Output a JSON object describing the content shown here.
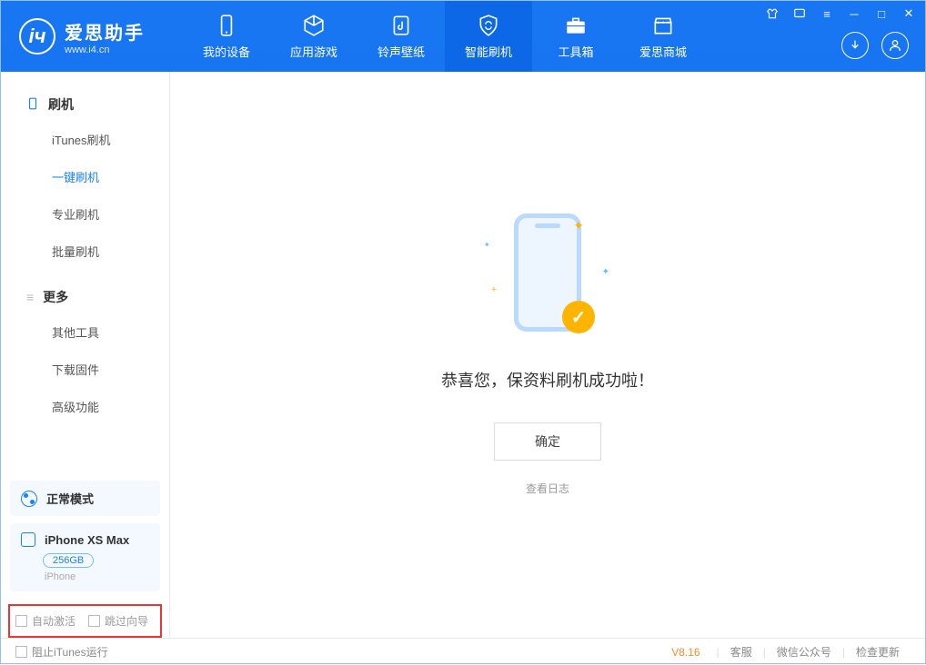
{
  "app": {
    "logo_title": "爱思助手",
    "logo_subtitle": "www.i4.cn"
  },
  "nav": {
    "tabs": [
      {
        "label": "我的设备"
      },
      {
        "label": "应用游戏"
      },
      {
        "label": "铃声壁纸"
      },
      {
        "label": "智能刷机"
      },
      {
        "label": "工具箱"
      },
      {
        "label": "爱思商城"
      }
    ]
  },
  "sidebar": {
    "section1_title": "刷机",
    "items1": [
      {
        "label": "iTunes刷机"
      },
      {
        "label": "一键刷机"
      },
      {
        "label": "专业刷机"
      },
      {
        "label": "批量刷机"
      }
    ],
    "section2_title": "更多",
    "items2": [
      {
        "label": "其他工具"
      },
      {
        "label": "下载固件"
      },
      {
        "label": "高级功能"
      }
    ],
    "mode_label": "正常模式",
    "device_name": "iPhone XS Max",
    "device_capacity": "256GB",
    "device_type": "iPhone",
    "checkbox1": "自动激活",
    "checkbox2": "跳过向导"
  },
  "main": {
    "success_text": "恭喜您，保资料刷机成功啦！",
    "ok_button": "确定",
    "log_link": "查看日志"
  },
  "footer": {
    "stop_itunes": "阻止iTunes运行",
    "version": "V8.16",
    "link1": "客服",
    "link2": "微信公众号",
    "link3": "检查更新"
  }
}
